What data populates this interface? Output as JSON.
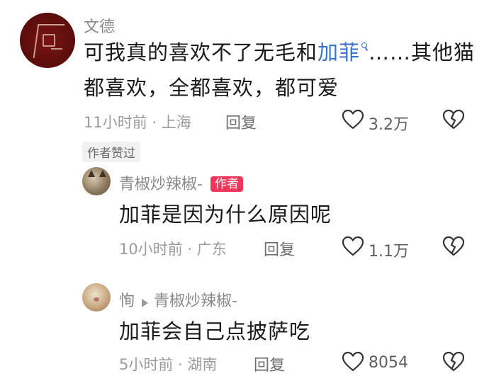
{
  "comment": {
    "author": "文德",
    "text_line1_before": "可我真的喜欢不了无毛和",
    "text_line1_link": "加菲",
    "text_line1_after": "……其他猫",
    "text_line2": "都喜欢，全都喜欢，都可爱",
    "meta": "11小时前 · 上海",
    "reply_label": "回复",
    "likes": "3.2万",
    "author_liked_tag": "作者赞过"
  },
  "replies": [
    {
      "author": "青椒炒辣椒-",
      "badge": "作者",
      "text": "加菲是因为什么原因呢",
      "meta": "10小时前 · 广东",
      "reply_label": "回复",
      "likes": "1.1万"
    },
    {
      "author": "恂",
      "reply_to": "青椒炒辣椒-",
      "text": "加菲会自己点披萨吃",
      "meta": "5小时前 · 湖南",
      "reply_label": "回复",
      "likes": "8054"
    }
  ],
  "colors": {
    "link": "#3a72c4",
    "badge": "#f2385a",
    "avatar_main": "#6b0f0f"
  }
}
